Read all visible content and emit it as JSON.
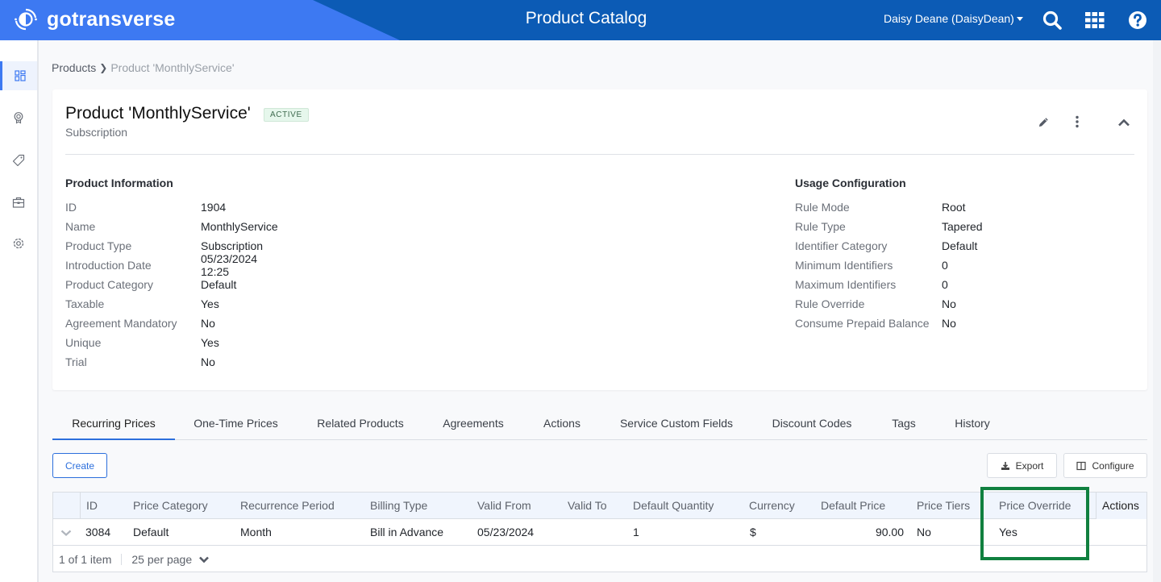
{
  "header": {
    "brand_name": "gotransverse",
    "app_title": "Product Catalog",
    "user_label": "Daisy Deane (DaisyDean)",
    "icons": [
      "search-icon",
      "apps-grid-icon",
      "help-icon"
    ],
    "colors": {
      "header_bg": "#0c5bb5",
      "brand_bg": "#3d79f2",
      "accent": "#2c6fdc",
      "highlight": "#10803f"
    }
  },
  "sidebar": {
    "items": [
      {
        "icon": "dashboard-icon",
        "active": true
      },
      {
        "icon": "award-icon",
        "active": false
      },
      {
        "icon": "tag-icon",
        "active": false
      },
      {
        "icon": "briefcase-icon",
        "active": false
      },
      {
        "icon": "settings-icon",
        "active": false
      }
    ]
  },
  "breadcrumb": {
    "parent": "Products",
    "current": "Product 'MonthlyService'"
  },
  "product": {
    "title": "Product 'MonthlyService'",
    "status": "ACTIVE",
    "subtitle": "Subscription",
    "info_section": {
      "title": "Product Information",
      "fields": [
        {
          "label": "ID",
          "value": "1904"
        },
        {
          "label": "Name",
          "value": "MonthlyService"
        },
        {
          "label": "Product Type",
          "value": "Subscription"
        },
        {
          "label": "Introduction Date",
          "value": "05/23/2024 12:25"
        },
        {
          "label": "Product Category",
          "value": "Default"
        },
        {
          "label": "Taxable",
          "value": "Yes"
        },
        {
          "label": "Agreement Mandatory",
          "value": "No"
        },
        {
          "label": "Unique",
          "value": "Yes"
        },
        {
          "label": "Trial",
          "value": "No"
        }
      ]
    },
    "usage_section": {
      "title": "Usage Configuration",
      "fields": [
        {
          "label": "Rule Mode",
          "value": "Root"
        },
        {
          "label": "Rule Type",
          "value": "Tapered"
        },
        {
          "label": "Identifier Category",
          "value": "Default"
        },
        {
          "label": "Minimum Identifiers",
          "value": "0"
        },
        {
          "label": "Maximum Identifiers",
          "value": "0"
        },
        {
          "label": "Rule Override",
          "value": "No"
        },
        {
          "label": "Consume Prepaid Balance",
          "value": "No"
        }
      ]
    }
  },
  "tabs": [
    {
      "label": "Recurring Prices",
      "active": true
    },
    {
      "label": "One-Time Prices",
      "active": false
    },
    {
      "label": "Related Products",
      "active": false
    },
    {
      "label": "Agreements",
      "active": false
    },
    {
      "label": "Actions",
      "active": false
    },
    {
      "label": "Service Custom Fields",
      "active": false
    },
    {
      "label": "Discount Codes",
      "active": false
    },
    {
      "label": "Tags",
      "active": false
    },
    {
      "label": "History",
      "active": false
    }
  ],
  "toolbar": {
    "create_label": "Create",
    "export_label": "Export",
    "configure_label": "Configure"
  },
  "grid": {
    "columns": [
      "ID",
      "Price Category",
      "Recurrence Period",
      "Billing Type",
      "Valid From",
      "Valid To",
      "Default Quantity",
      "Currency",
      "Default Price",
      "Price Tiers",
      "Price Override",
      "Actions"
    ],
    "rows": [
      [
        "3084",
        "Default",
        "Month",
        "Bill in Advance",
        "05/23/2024",
        "",
        "1",
        "$",
        "90.00",
        "No",
        "Yes",
        ""
      ]
    ],
    "footer": {
      "item_count": "1 of 1 item",
      "per_page": "25 per page"
    },
    "highlighted_column": "Price Override"
  }
}
